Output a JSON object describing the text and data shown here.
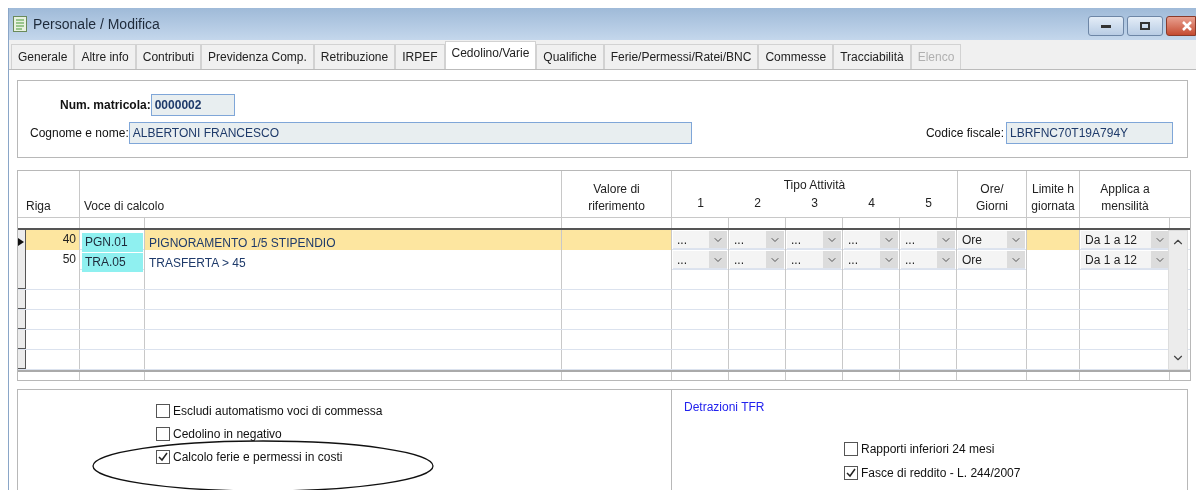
{
  "window": {
    "title": "Personale / Modifica"
  },
  "tabs": [
    {
      "label": "Generale",
      "selected": false,
      "disabled": false
    },
    {
      "label": "Altre info",
      "selected": false,
      "disabled": false
    },
    {
      "label": "Contributi",
      "selected": false,
      "disabled": false
    },
    {
      "label": "Previdenza Comp.",
      "selected": false,
      "disabled": false
    },
    {
      "label": "Retribuzione",
      "selected": false,
      "disabled": false
    },
    {
      "label": "IRPEF",
      "selected": false,
      "disabled": false
    },
    {
      "label": "Cedolino/Varie",
      "selected": true,
      "disabled": false
    },
    {
      "label": "Qualifiche",
      "selected": false,
      "disabled": false
    },
    {
      "label": "Ferie/Permessi/Ratei/BNC",
      "selected": false,
      "disabled": false
    },
    {
      "label": "Commesse",
      "selected": false,
      "disabled": false
    },
    {
      "label": "Tracciabilità",
      "selected": false,
      "disabled": false
    },
    {
      "label": "Elenco",
      "selected": false,
      "disabled": true
    }
  ],
  "header": {
    "matricola": {
      "label": "Num. matricola:",
      "value": "0000002"
    },
    "nome": {
      "label": "Cognome e nome:",
      "value": "ALBERTONI FRANCESCO"
    },
    "codice_fiscale": {
      "label": "Codice fiscale:",
      "value": "LBRFNC70T19A794Y"
    }
  },
  "table": {
    "columns": {
      "riga": "Riga",
      "voce": "Voce di calcolo",
      "valore": [
        "Valore di",
        "riferimento"
      ],
      "tipo": "Tipo Attività",
      "tipo_sub": [
        "1",
        "2",
        "3",
        "4",
        "5"
      ],
      "ore": [
        "Ore/",
        "Giorni"
      ],
      "limite": [
        "Limite h",
        "giornata"
      ],
      "applica": [
        "Applica a",
        "mensilità"
      ]
    },
    "rows": [
      {
        "riga": "40",
        "code": "PGN.01",
        "description": "PIGNORAMENTO 1/5 STIPENDIO",
        "tipo": [
          "...",
          "...",
          "...",
          "...",
          "..."
        ],
        "ore": "Ore",
        "applica": "Da 1 a 12",
        "selected": true
      },
      {
        "riga": "50",
        "code": "TRA.05",
        "description": "TRASFERTA > 45",
        "tipo": [
          "...",
          "...",
          "...",
          "...",
          "..."
        ],
        "ore": "Ore",
        "applica": "Da 1 a 12",
        "selected": false
      }
    ]
  },
  "options": [
    {
      "label": "Escludi automatismo voci di commessa",
      "checked": false
    },
    {
      "label": "Cedolino in negativo",
      "checked": false
    },
    {
      "label": "Calcolo ferie e permessi in costi",
      "checked": true
    }
  ],
  "detrazioni": {
    "title": "Detrazioni TFR",
    "options": [
      {
        "label": "Rapporti inferiori 24 mesi",
        "checked": false
      },
      {
        "label": "Fasce di reddito - L. 244/2007",
        "checked": true
      }
    ]
  }
}
